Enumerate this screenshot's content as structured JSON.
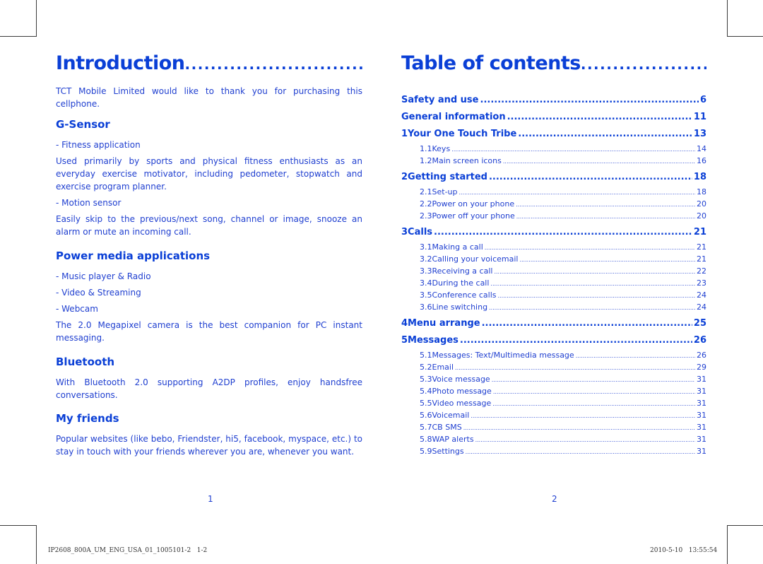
{
  "left_page": {
    "title": "Introduction",
    "title_leader": "...............................",
    "intro": "TCT Mobile Limited would like to thank you for purchasing this cellphone.",
    "sections": [
      {
        "heading": "G-Sensor",
        "blocks": [
          {
            "type": "bullet",
            "text": "- Fitness application"
          },
          {
            "type": "para",
            "text": "Used primarily by sports and physical fitness enthusiasts as an everyday exercise motivator, including pedometer, stopwatch and exercise program planner."
          },
          {
            "type": "bullet",
            "text": "- Motion sensor"
          },
          {
            "type": "para",
            "text": "Easily skip to the previous/next song, channel or image, snooze an alarm or mute an incoming call."
          }
        ]
      },
      {
        "heading": "Power media applications",
        "blocks": [
          {
            "type": "bullet",
            "text": "- Music player & Radio"
          },
          {
            "type": "bullet",
            "text": "- Video & Streaming"
          },
          {
            "type": "bullet",
            "text": "- Webcam"
          },
          {
            "type": "para",
            "text": "The 2.0 Megapixel camera is the best companion for PC instant messaging."
          }
        ]
      },
      {
        "heading": "Bluetooth",
        "blocks": [
          {
            "type": "para",
            "text": "With Bluetooth 2.0 supporting A2DP profiles, enjoy handsfree conversations."
          }
        ]
      },
      {
        "heading": "My friends",
        "blocks": [
          {
            "type": "para",
            "text": "Popular websites (like bebo, Friendster, hi5, facebook, myspace, etc.) to stay in touch with your friends wherever you are, whenever you want."
          }
        ]
      }
    ],
    "page_number": "1"
  },
  "right_page": {
    "title": "Table of contents",
    "title_leader": "........................",
    "toc": [
      {
        "num": "",
        "label": "Safety and use",
        "page": "6",
        "sections": []
      },
      {
        "num": "",
        "label": "General information",
        "page": "11",
        "sections": []
      },
      {
        "num": "1",
        "label": "Your One Touch Tribe",
        "page": "13",
        "sections": [
          {
            "num": "1.1",
            "label": "Keys",
            "page": "14"
          },
          {
            "num": "1.2",
            "label": "Main screen icons",
            "page": "16"
          }
        ]
      },
      {
        "num": "2",
        "label": "Getting started",
        "page": "18",
        "sections": [
          {
            "num": "2.1",
            "label": "Set-up",
            "page": "18"
          },
          {
            "num": "2.2",
            "label": "Power on your phone",
            "page": "20"
          },
          {
            "num": "2.3",
            "label": "Power off your phone",
            "page": "20"
          }
        ]
      },
      {
        "num": "3",
        "label": "Calls",
        "page": "21",
        "sections": [
          {
            "num": "3.1",
            "label": "Making a call",
            "page": "21"
          },
          {
            "num": "3.2",
            "label": "Calling your voicemail",
            "page": "21"
          },
          {
            "num": "3.3",
            "label": "Receiving a call",
            "page": "22"
          },
          {
            "num": "3.4",
            "label": "During the call",
            "page": "23"
          },
          {
            "num": "3.5",
            "label": "Conference calls",
            "page": "24"
          },
          {
            "num": "3.6",
            "label": "Line switching",
            "page": "24"
          }
        ]
      },
      {
        "num": "4",
        "label": "Menu arrange",
        "page": "25",
        "sections": []
      },
      {
        "num": "5",
        "label": "Messages",
        "page": "26",
        "sections": [
          {
            "num": "5.1",
            "label": "Messages: Text/Multimedia message",
            "page": "26"
          },
          {
            "num": "5.2",
            "label": "Email",
            "page": "29"
          },
          {
            "num": "5.3",
            "label": "Voice message",
            "page": "31"
          },
          {
            "num": "5.4",
            "label": "Photo message",
            "page": "31"
          },
          {
            "num": "5.5",
            "label": "Video message",
            "page": "31"
          },
          {
            "num": "5.6",
            "label": "Voicemail",
            "page": "31"
          },
          {
            "num": "5.7",
            "label": "CB SMS",
            "page": "31"
          },
          {
            "num": "5.8",
            "label": "WAP alerts",
            "page": "31"
          },
          {
            "num": "5.9",
            "label": "Settings",
            "page": "31"
          }
        ]
      }
    ],
    "page_number": "2"
  },
  "footer": {
    "file_id": "IP2608_800A_UM_ENG_USA_01_1005101-2",
    "page_range": "1-2",
    "date": "2010-5-10",
    "time": "13:55:54"
  },
  "colors": {
    "heading": "#0a3fd6",
    "body": "#1f3fd0",
    "crop_marks": "#3a3a3a"
  }
}
